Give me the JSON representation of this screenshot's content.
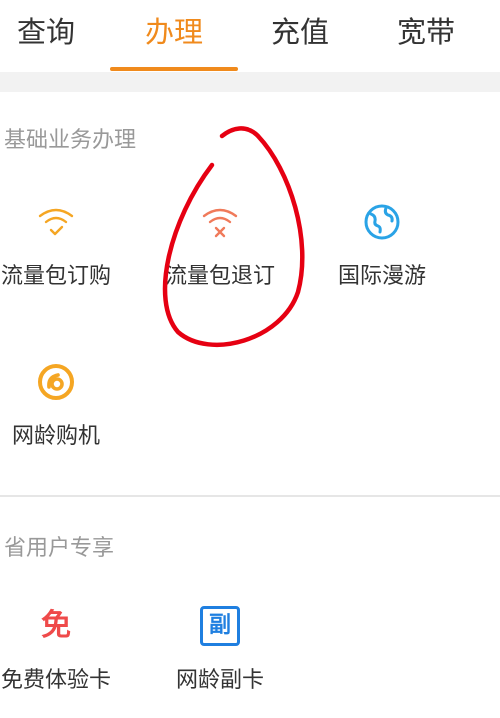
{
  "tabs": [
    {
      "label": "查询"
    },
    {
      "label": "办理"
    },
    {
      "label": "充值"
    },
    {
      "label": "宽带"
    }
  ],
  "accent_color": "#f08a1c",
  "sections": {
    "basic": {
      "title": "基础业务办理",
      "items": [
        {
          "label": "流量包订购",
          "icon": "wifi-check-icon"
        },
        {
          "label": "流量包退订",
          "icon": "wifi-cancel-icon"
        },
        {
          "label": "国际漫游",
          "icon": "globe-icon"
        },
        {
          "label": "网龄购机",
          "icon": "phone-age-icon"
        }
      ]
    },
    "exclusive": {
      "title": "省用户专享",
      "items": [
        {
          "label": "免费体验卡",
          "icon": "free-card-icon",
          "glyph": "免"
        },
        {
          "label": "网龄副卡",
          "icon": "secondary-card-icon",
          "glyph": "副"
        }
      ]
    }
  }
}
